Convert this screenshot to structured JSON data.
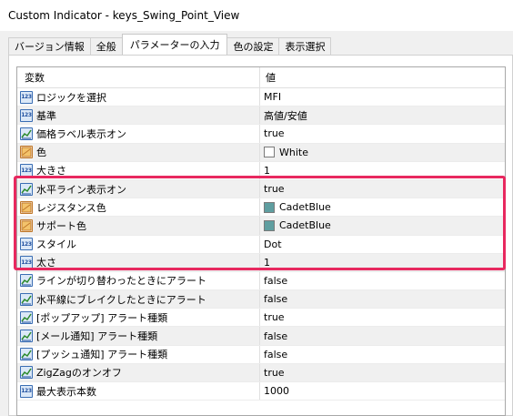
{
  "window": {
    "title": "Custom Indicator - keys_Swing_Point_View"
  },
  "tabs": [
    {
      "label": "バージョン情報"
    },
    {
      "label": "全般"
    },
    {
      "label": "パラメーターの入力"
    },
    {
      "label": "色の設定"
    },
    {
      "label": "表示選択"
    }
  ],
  "grid": {
    "col_variable": "変数",
    "col_value": "値",
    "rows": [
      {
        "icon": "number-icon",
        "name": "ロジックを選択",
        "value": "MFI"
      },
      {
        "icon": "number-icon",
        "name": "基準",
        "value": "高値/安値"
      },
      {
        "icon": "chart-icon",
        "name": "価格ラベル表示オン",
        "value": "true"
      },
      {
        "icon": "color-icon",
        "name": "色",
        "value": "White",
        "swatch": "#ffffff"
      },
      {
        "icon": "number-icon",
        "name": "大きさ",
        "value": "1"
      },
      {
        "icon": "chart-icon",
        "name": "水平ライン表示オン",
        "value": "true"
      },
      {
        "icon": "color-icon",
        "name": "レジスタンス色",
        "value": "CadetBlue",
        "swatch": "#5f9ea0"
      },
      {
        "icon": "color-icon",
        "name": "サポート色",
        "value": "CadetBlue",
        "swatch": "#5f9ea0"
      },
      {
        "icon": "number-icon",
        "name": "スタイル",
        "value": "Dot"
      },
      {
        "icon": "number-icon",
        "name": "太さ",
        "value": "1"
      },
      {
        "icon": "chart-icon",
        "name": "ラインが切り替わったときにアラート",
        "value": "false"
      },
      {
        "icon": "chart-icon",
        "name": "水平線にブレイクしたときにアラート",
        "value": "false"
      },
      {
        "icon": "chart-icon",
        "name": "[ポップアップ] アラート種類",
        "value": "true"
      },
      {
        "icon": "chart-icon",
        "name": "[メール通知] アラート種類",
        "value": "false"
      },
      {
        "icon": "chart-icon",
        "name": "[プッシュ通知] アラート種類",
        "value": "false"
      },
      {
        "icon": "chart-icon",
        "name": "ZigZagのオンオフ",
        "value": "true"
      },
      {
        "icon": "number-icon",
        "name": "最大表示本数",
        "value": "1000"
      }
    ]
  },
  "highlight_color": "#e8285f",
  "number_icon_text": "123"
}
